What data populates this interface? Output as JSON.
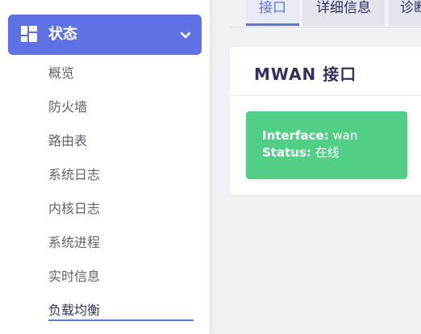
{
  "sidebar": {
    "menu_title": "状态",
    "items": [
      {
        "label": "概览"
      },
      {
        "label": "防火墙"
      },
      {
        "label": "路由表"
      },
      {
        "label": "系统日志"
      },
      {
        "label": "内核日志"
      },
      {
        "label": "系统进程"
      },
      {
        "label": "实时信息"
      },
      {
        "label": "负载均衡"
      }
    ],
    "active_item": "负载均衡"
  },
  "tabs": [
    {
      "label": "接口"
    },
    {
      "label": "详细信息"
    },
    {
      "label": "诊断"
    }
  ],
  "card": {
    "title": "MWAN 接口",
    "interface": {
      "key": "Interface:",
      "value": "wan",
      "status_key": "Status:",
      "status_value": "在线"
    }
  },
  "colors": {
    "accent": "#5e72e4",
    "online_green": "#52cf86",
    "background": "#f1f2f6",
    "text_dark": "#32325d"
  },
  "icons": {
    "menu_icon": "dashboard-grid-icon",
    "expand_icon": "chevron-down-icon"
  }
}
